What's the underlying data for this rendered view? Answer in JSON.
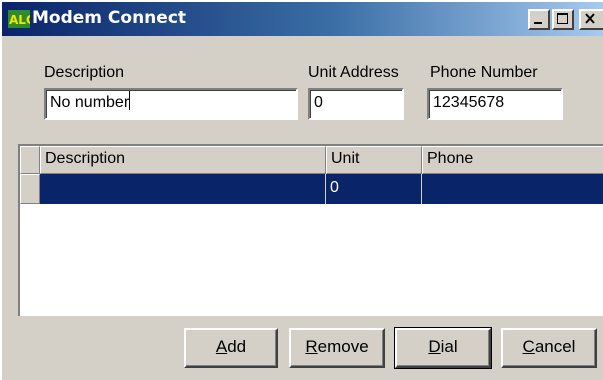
{
  "window": {
    "title": "Modem Connect",
    "icon": "alc-logo-icon",
    "controls": [
      "minimize-icon",
      "maximize-icon",
      "close-icon"
    ]
  },
  "form": {
    "description_label": "Description",
    "description_value": "No number",
    "unit_address_label": "Unit Address",
    "unit_address_value": "0",
    "phone_number_label": "Phone Number",
    "phone_number_value": "12345678"
  },
  "grid": {
    "columns": [
      "Description",
      "Unit",
      "Phone"
    ],
    "rows": [
      {
        "description": "",
        "unit": "0",
        "phone": ""
      }
    ]
  },
  "buttons": {
    "add": {
      "key": "A",
      "rest": "dd"
    },
    "remove": {
      "key": "R",
      "rest": "emove"
    },
    "dial": {
      "key": "D",
      "rest": "ial"
    },
    "cancel": {
      "key": "C",
      "rest": "ancel"
    }
  },
  "colors": {
    "title_gradient_start": "#0a246a",
    "title_gradient_end": "#a6caf0",
    "selection": "#0a246a",
    "face": "#d4d0c8",
    "logo_yellow": "#f0e800",
    "logo_green": "#2e8b2e"
  }
}
